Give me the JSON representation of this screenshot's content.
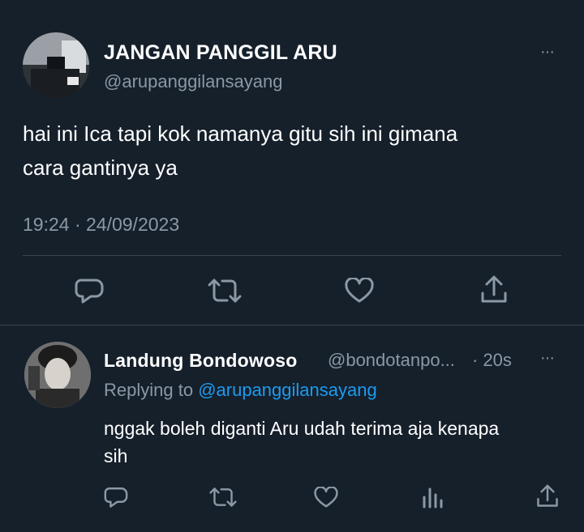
{
  "main_tweet": {
    "display_name": "JANGAN PANGGIL ARU",
    "handle": "@arupanggilansayang",
    "text_line1": "hai ini Ica tapi kok namanya gitu sih ini gimana",
    "text_line2": "cara gantinya ya",
    "timestamp": "19:24 · 24/09/2023",
    "more_label": "···"
  },
  "reply": {
    "display_name": "Landung Bondowoso",
    "handle": "@bondotanpo...",
    "time": "· 20s",
    "replying_prefix": "Replying to",
    "replying_handle": "@arupanggilansayang",
    "text_line1": "nggak boleh diganti Aru udah terima aja kenapa",
    "text_line2": "sih",
    "more_label": "···"
  },
  "colors": {
    "background": "#15202b",
    "text": "#ffffff",
    "muted": "#8b98a5",
    "link": "#1d9bf0",
    "divider": "#38444d"
  },
  "icons": {
    "main_actions": [
      "reply-icon",
      "retweet-icon",
      "like-icon",
      "share-icon"
    ],
    "reply_actions": [
      "reply-icon",
      "retweet-icon",
      "like-icon",
      "views-icon",
      "share-icon"
    ]
  }
}
